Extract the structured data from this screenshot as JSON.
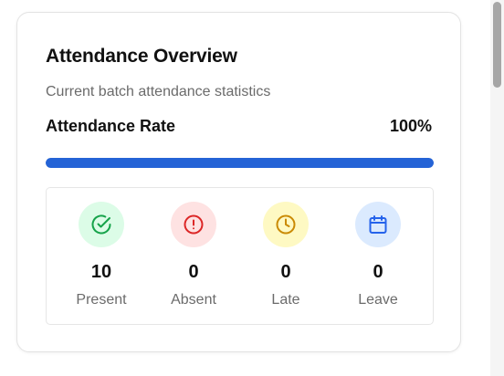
{
  "card": {
    "title": "Attendance Overview",
    "subtitle": "Current batch attendance statistics",
    "rate_label": "Attendance Rate",
    "rate_value": "100%",
    "rate_fraction": 1.0
  },
  "stats": [
    {
      "count": "10",
      "label": "Present",
      "icon": "check-circle-icon",
      "bg": "#dcfce7",
      "fg": "#16a34a"
    },
    {
      "count": "0",
      "label": "Absent",
      "icon": "alert-circle-icon",
      "bg": "#fee2e2",
      "fg": "#dc2626"
    },
    {
      "count": "0",
      "label": "Late",
      "icon": "clock-icon",
      "bg": "#fef9c3",
      "fg": "#ca8a04"
    },
    {
      "count": "0",
      "label": "Leave",
      "icon": "calendar-icon",
      "bg": "#dbeafe",
      "fg": "#2563eb"
    }
  ],
  "colors": {
    "progress": "#2463d6"
  }
}
